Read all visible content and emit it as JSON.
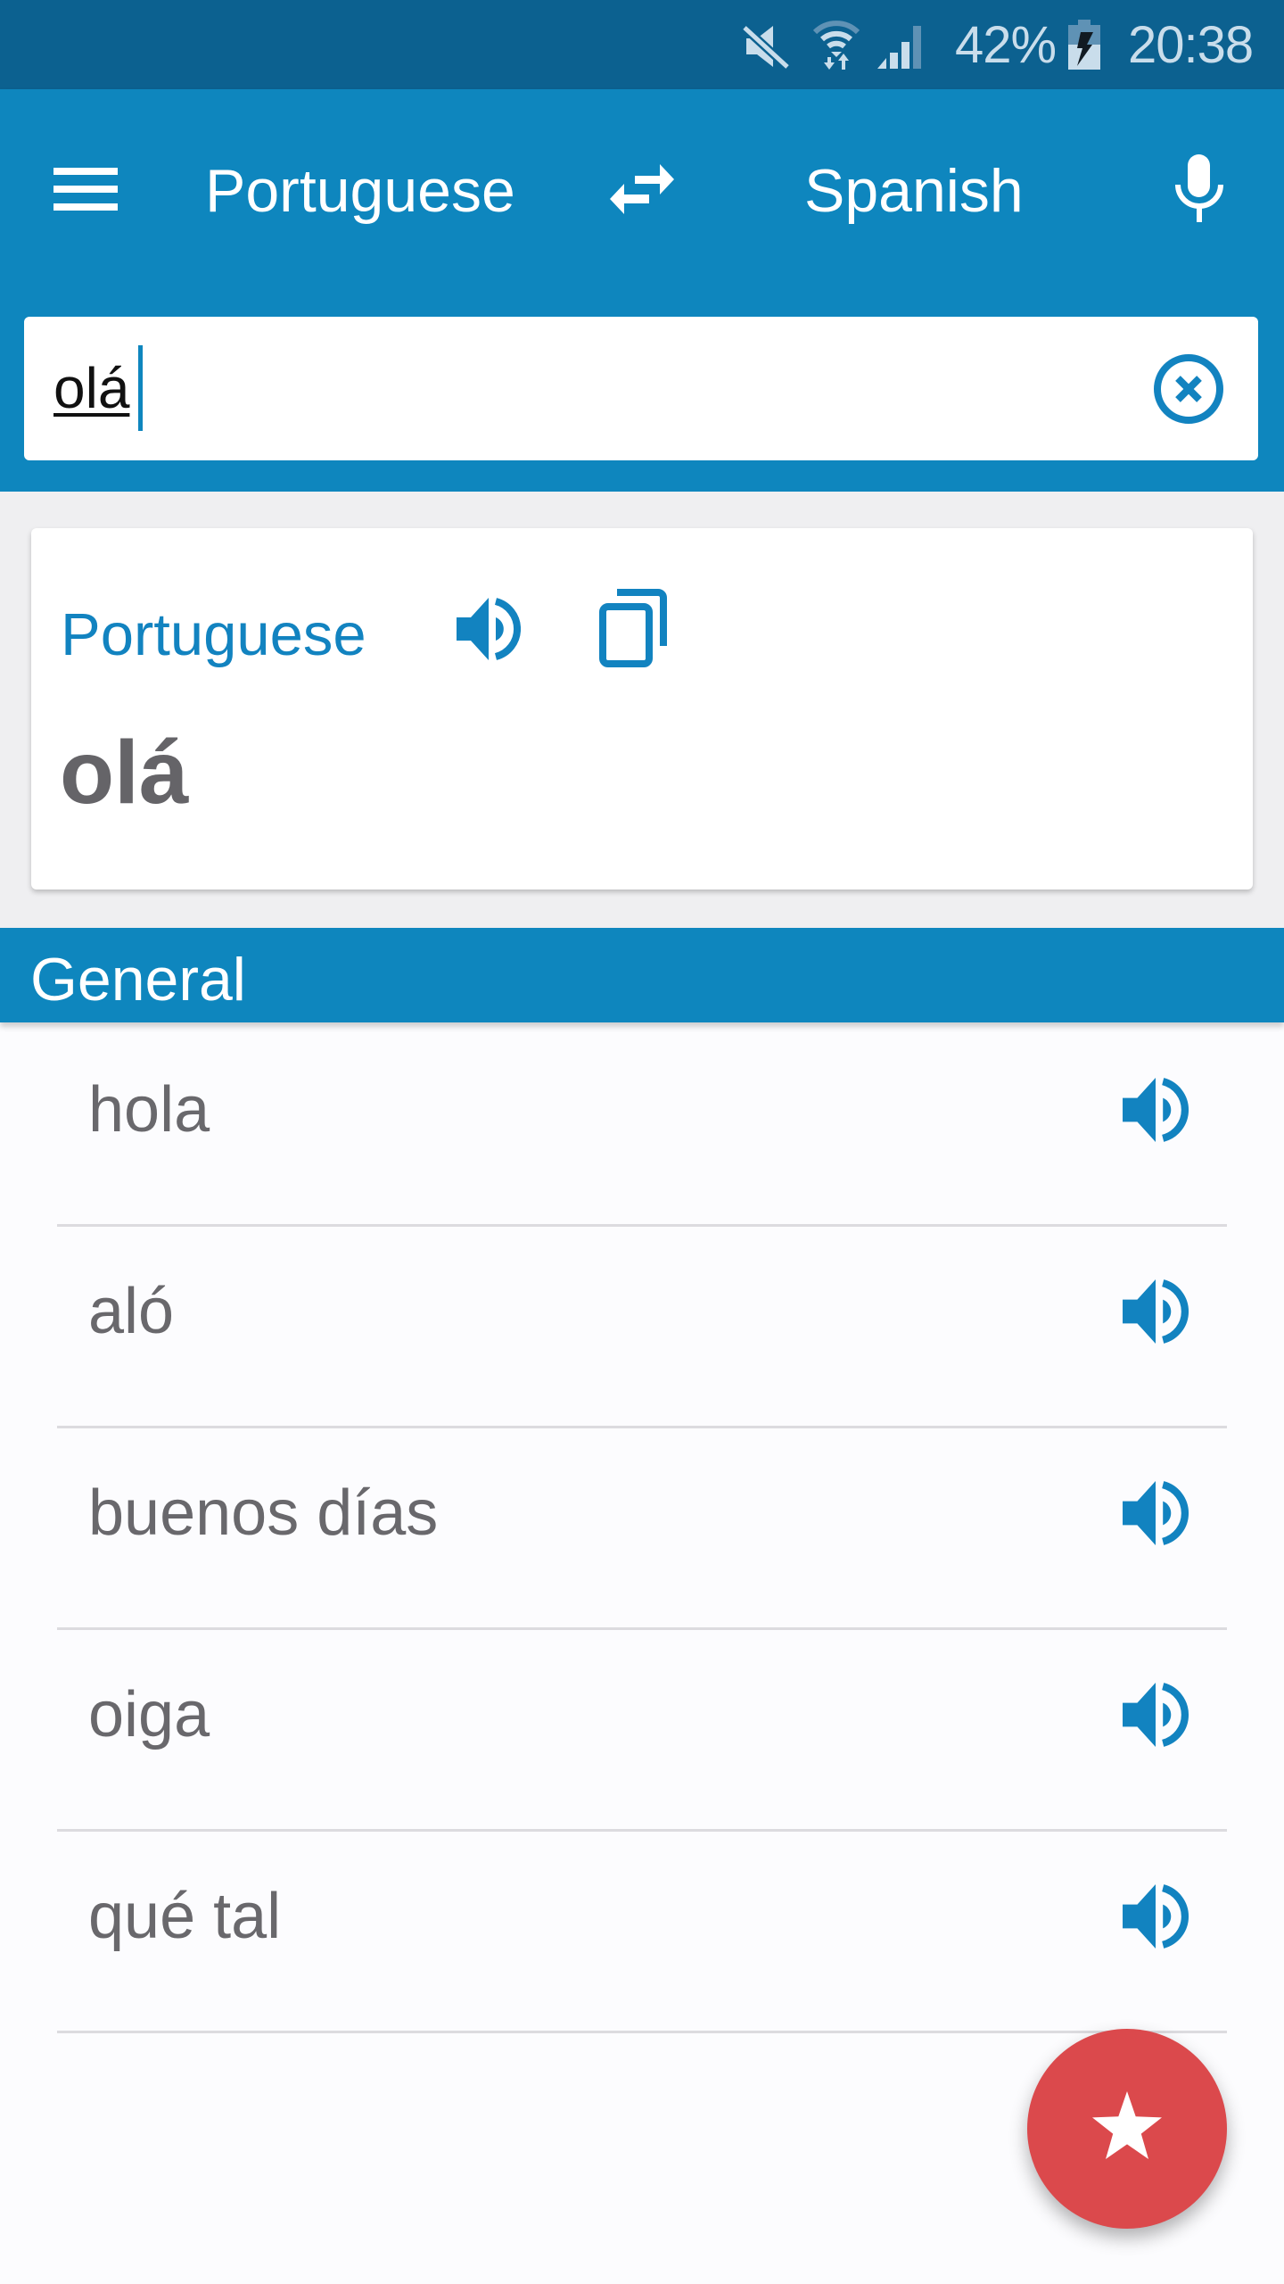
{
  "colors": {
    "status_bar": "#0C6190",
    "primary": "#0E86BE",
    "accent_icon": "#1283C0",
    "fab": "#DB494C",
    "word_text": "#69686C",
    "background": "#EFEFF1"
  },
  "status_bar": {
    "icons": [
      "mute-icon",
      "wifi-icon",
      "signal-icon",
      "battery-charging-icon"
    ],
    "battery_percent": "42%",
    "time": "20:38"
  },
  "toolbar": {
    "menu_icon": "hamburger-menu-icon",
    "source_language": "Portuguese",
    "swap_icon": "swap-arrows-icon",
    "target_language": "Spanish",
    "mic_icon": "microphone-icon"
  },
  "search": {
    "value": "olá",
    "clear_icon": "clear-circle-x-icon"
  },
  "source_card": {
    "language": "Portuguese",
    "speak_icon": "speaker-icon",
    "copy_icon": "copy-icon",
    "word": "olá"
  },
  "section": {
    "title": "General"
  },
  "translations": [
    {
      "text": "hola",
      "speak_icon": "speaker-icon"
    },
    {
      "text": "aló",
      "speak_icon": "speaker-icon"
    },
    {
      "text": "buenos días",
      "speak_icon": "speaker-icon"
    },
    {
      "text": "oiga",
      "speak_icon": "speaker-icon"
    },
    {
      "text": "qué tal",
      "speak_icon": "speaker-icon"
    }
  ],
  "fab": {
    "icon": "star-icon"
  }
}
